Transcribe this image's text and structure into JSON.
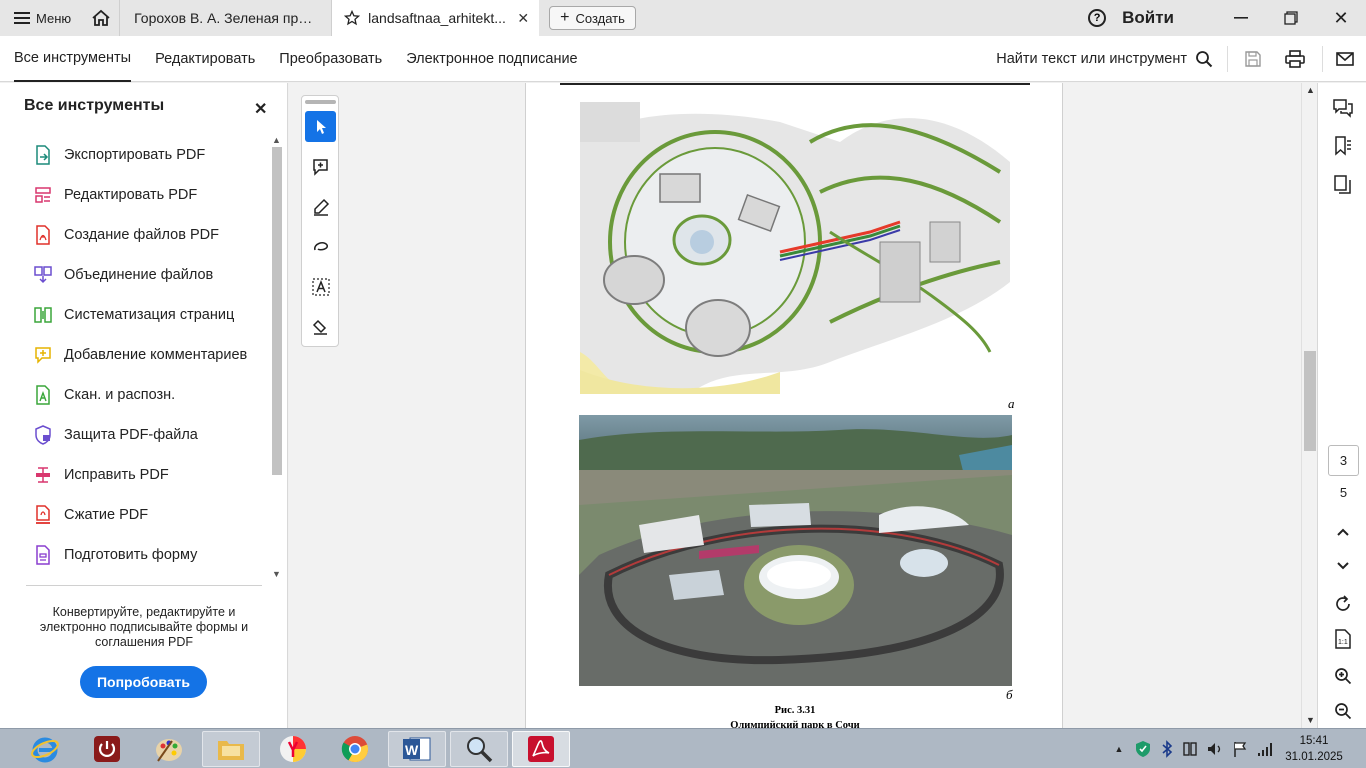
{
  "tabbar": {
    "menu_label": "Меню",
    "tabs": [
      {
        "label": "Горохов В. А. Зеленая при..."
      },
      {
        "label": "landsaftnaa_arhitekt..."
      }
    ],
    "create_label": "Создать",
    "signin_label": "Войти"
  },
  "toolbar": {
    "tabs": [
      "Все инструменты",
      "Редактировать",
      "Преобразовать",
      "Электронное подписание"
    ],
    "find_label": "Найти текст или инструмент"
  },
  "left_panel": {
    "title": "Все инструменты",
    "items": [
      {
        "label": "Экспортировать PDF",
        "icon": "export-pdf-icon",
        "color": "#1c8a7a"
      },
      {
        "label": "Редактировать PDF",
        "icon": "edit-pdf-icon",
        "color": "#d9376e"
      },
      {
        "label": "Создание файлов PDF",
        "icon": "create-pdf-icon",
        "color": "#e0302a"
      },
      {
        "label": "Объединение файлов",
        "icon": "combine-files-icon",
        "color": "#6b4ecf"
      },
      {
        "label": "Систематизация страниц",
        "icon": "organize-pages-icon",
        "color": "#3aa63a"
      },
      {
        "label": "Добавление комментариев",
        "icon": "comment-icon",
        "color": "#e6b400"
      },
      {
        "label": "Скан. и распозн.",
        "icon": "scan-ocr-icon",
        "color": "#3aa63a"
      },
      {
        "label": "Защита PDF-файла",
        "icon": "protect-pdf-icon",
        "color": "#6b4ecf"
      },
      {
        "label": "Исправить PDF",
        "icon": "redact-pdf-icon",
        "color": "#d9376e"
      },
      {
        "label": "Сжатие PDF",
        "icon": "compress-pdf-icon",
        "color": "#e0302a"
      },
      {
        "label": "Подготовить форму",
        "icon": "prepare-form-icon",
        "color": "#8a3fcf"
      }
    ],
    "promo_text": "Конвертируйте, редактируйте и электронно подписывайте формы и соглашения PDF",
    "try_button": "Попробовать"
  },
  "document": {
    "label_a": "а",
    "label_b": "б",
    "figure_number": "Рис. 3.31",
    "figure_caption": "Олимпийский парк в Сочи"
  },
  "page_nav": {
    "current": "3",
    "total": "5"
  },
  "taskbar": {
    "time": "15:41",
    "date": "31.01.2025"
  },
  "colors": {
    "accent": "#1473e6"
  }
}
